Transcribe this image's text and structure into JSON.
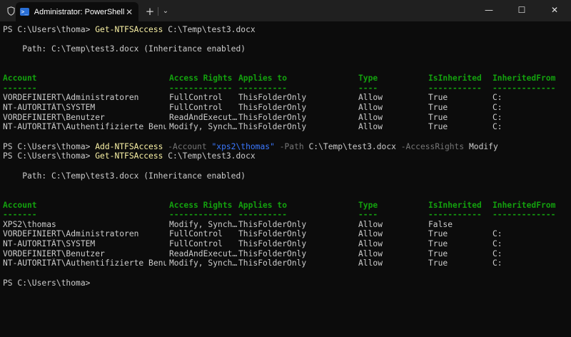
{
  "titlebar": {
    "tab_title": "Administrator: PowerShell",
    "tab_icon_glyph": ">_",
    "new_tab": "+",
    "dropdown": "⌄",
    "close_tab": "✕",
    "minimize": "—",
    "maximize": "☐",
    "close": "✕"
  },
  "colors": {
    "background": "#0c0c0c",
    "command": "#f9f1a5",
    "parameter": "#767676",
    "string": "#3b78ff",
    "header": "#13a10e"
  },
  "console": {
    "block1": {
      "prompt": "PS C:\\Users\\thoma> ",
      "command": "Get-NTFSAccess",
      "args": " C:\\Temp\\test3.docx",
      "path_line": "    Path: C:\\Temp\\test3.docx (Inheritance enabled)",
      "headers": [
        "Account",
        "Access Rights",
        "Applies to",
        "Type",
        "IsInherited",
        "InheritedFrom"
      ],
      "underlines": [
        "-------",
        "-------------",
        "----------",
        "----",
        "-----------",
        "-------------"
      ],
      "rows": [
        [
          "VORDEFINIERT\\Administratoren",
          "FullControl",
          "ThisFolderOnly",
          "Allow",
          "True",
          "C:"
        ],
        [
          "NT-AUTORITÄT\\SYSTEM",
          "FullControl",
          "ThisFolderOnly",
          "Allow",
          "True",
          "C:"
        ],
        [
          "VORDEFINIERT\\Benutzer",
          "ReadAndExecut…",
          "ThisFolderOnly",
          "Allow",
          "True",
          "C:"
        ],
        [
          "NT-AUTORITÄT\\Authentifizierte Benu…",
          "Modify, Synch…",
          "ThisFolderOnly",
          "Allow",
          "True",
          "C:"
        ]
      ]
    },
    "add_cmd": {
      "prompt": "PS C:\\Users\\thoma> ",
      "command": "Add-NTFSAccess",
      "p_account": " -Account ",
      "account_value": "\"xps2\\thomas\"",
      "p_path": " -Path ",
      "path_value": "C:\\Temp\\test3.docx",
      "p_rights": " -AccessRights ",
      "rights_value": "Modify"
    },
    "block2": {
      "prompt": "PS C:\\Users\\thoma> ",
      "command": "Get-NTFSAccess",
      "args": " C:\\Temp\\test3.docx",
      "path_line": "    Path: C:\\Temp\\test3.docx (Inheritance enabled)",
      "headers": [
        "Account",
        "Access Rights",
        "Applies to",
        "Type",
        "IsInherited",
        "InheritedFrom"
      ],
      "underlines": [
        "-------",
        "-------------",
        "----------",
        "----",
        "-----------",
        "-------------"
      ],
      "rows": [
        [
          "XPS2\\thomas",
          "Modify, Synch…",
          "ThisFolderOnly",
          "Allow",
          "False",
          ""
        ],
        [
          "VORDEFINIERT\\Administratoren",
          "FullControl",
          "ThisFolderOnly",
          "Allow",
          "True",
          "C:"
        ],
        [
          "NT-AUTORITÄT\\SYSTEM",
          "FullControl",
          "ThisFolderOnly",
          "Allow",
          "True",
          "C:"
        ],
        [
          "VORDEFINIERT\\Benutzer",
          "ReadAndExecut…",
          "ThisFolderOnly",
          "Allow",
          "True",
          "C:"
        ],
        [
          "NT-AUTORITÄT\\Authentifizierte Benu…",
          "Modify, Synch…",
          "ThisFolderOnly",
          "Allow",
          "True",
          "C:"
        ]
      ]
    },
    "final_prompt": "PS C:\\Users\\thoma>"
  }
}
